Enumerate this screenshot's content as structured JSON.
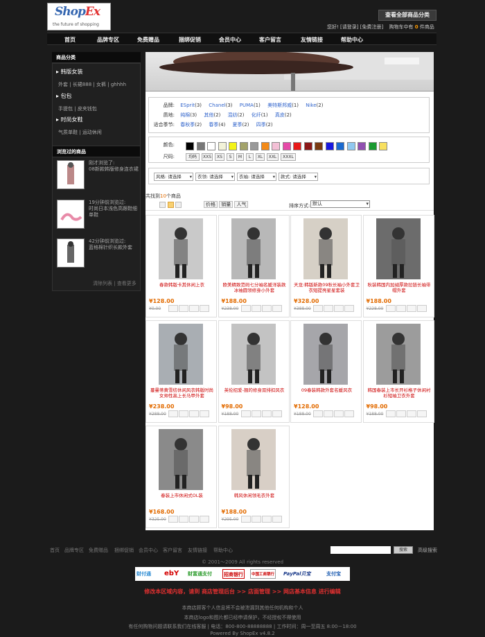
{
  "brand": {
    "logo_name": "Shop",
    "logo_mark": "Ex",
    "tagline": "the future of shopping"
  },
  "header": {
    "category_button": "查看全部商品分类",
    "greeting": "您好!",
    "login": "[请登录]",
    "register": "[免费注册]",
    "cart_prefix": "购物车中有",
    "cart_count": "0",
    "cart_suffix": "件商品"
  },
  "nav": [
    "首页",
    "品牌专区",
    "免费赠品",
    "捆绑促销",
    "会员中心",
    "客户留言",
    "友情链接",
    "帮助中心"
  ],
  "sidebar": {
    "category_title": "商品分类",
    "groups": [
      {
        "name": "韩版女装",
        "items": [
          "外套",
          "长裙888",
          "女裤",
          "ghhhh"
        ]
      },
      {
        "name": "包包",
        "items": [
          "手提包",
          "皮夹钱包"
        ]
      },
      {
        "name": "时尚女鞋",
        "items": [
          "气质单鞋",
          "运动休闲"
        ]
      }
    ],
    "history_title": "浏览过的商品",
    "history": [
      {
        "time": "刚才浏览了:",
        "name": "08新款韩版修身连衣裙"
      },
      {
        "time": "19分钟前浏览过:",
        "name": "时尚日本浅色高跟鞋细单鞋"
      },
      {
        "time": "42分钟前浏览过:",
        "name": "蓝格棉针织长款外套"
      }
    ],
    "clear_history": "清除列表",
    "more_history": "查看更多"
  },
  "filters": {
    "brand_label": "品牌:",
    "brands": [
      {
        "name": "ESprit",
        "count": "(3)"
      },
      {
        "name": "Chanel",
        "count": "(3)"
      },
      {
        "name": "PUMA",
        "count": "(1)"
      },
      {
        "name": "美特斯邦威",
        "count": "(1)"
      },
      {
        "name": "Nike",
        "count": "(2)"
      }
    ],
    "material_label": "质地:",
    "materials": [
      {
        "name": "纯棉",
        "count": "(3)"
      },
      {
        "name": "其他",
        "count": "(2)"
      },
      {
        "name": "混纺",
        "count": "(2)"
      },
      {
        "name": "化纤",
        "count": "(1)"
      },
      {
        "name": "真皮",
        "count": "(2)"
      }
    ],
    "season_label": "适合季节:",
    "seasons": [
      {
        "name": "春秋季",
        "count": "(2)"
      },
      {
        "name": "春季",
        "count": "(4)"
      },
      {
        "name": "夏季",
        "count": "(2)"
      },
      {
        "name": "四季",
        "count": "(2)"
      }
    ],
    "color_label": "颜色:",
    "colors": [
      "#000000",
      "#777777",
      "#ffffff",
      "#f2f2d8",
      "#f3f318",
      "#a3a36a",
      "#999999",
      "#f38a18",
      "#f3c0d6",
      "#e64aa8",
      "#e81818",
      "#8c1818",
      "#7a3a12",
      "#1818e0",
      "#1a6ad0",
      "#90c8f0",
      "#9050b0",
      "#1a9a30",
      "#f8e060"
    ],
    "size_label": "尺码:",
    "sizes": [
      "均码",
      "XXS",
      "XS",
      "S",
      "M",
      "L",
      "XL",
      "XXL",
      "XXXL"
    ],
    "dropdowns": [
      {
        "label": "风格:",
        "value": "请选择"
      },
      {
        "label": "衣领:",
        "value": "请选择"
      },
      {
        "label": "衣袖:",
        "value": "请选择"
      },
      {
        "label": "款式:",
        "value": "请选择"
      }
    ]
  },
  "results": {
    "prefix": "共找到",
    "count": "10",
    "suffix": "个商品"
  },
  "sort": {
    "buttons": [
      "价格",
      "销量",
      "人气"
    ],
    "label": "排序方式:",
    "value": "默认"
  },
  "products": [
    {
      "name": "春款韩版卡其休闲上衣",
      "price": "¥128.00",
      "old": "¥0.00",
      "img": "#c9c9c9"
    },
    {
      "name": "欧美精致范码七分袖名媛洋装款冰袖圆领修身小外套",
      "price": "¥188.00",
      "old": "¥238.00",
      "img": "#b8b8b8"
    },
    {
      "name": "天龙:韩版新款09秋长袖小外套卫衣短提亮星星套装",
      "price": "¥328.00",
      "old": "¥388.00",
      "img": "#d6d0c6"
    },
    {
      "name": "秋装韩国内加绒厚款拉链长袖带帽外套",
      "price": "¥188.00",
      "old": "¥228.00",
      "img": "#6c6c6c"
    },
    {
      "name": "蔓曼蒂黄雪纺休闲风衣韩版时尚女帅性高上长马甲外套",
      "price": "¥238.00",
      "old": "¥288.00",
      "img": "#a9aeb3"
    },
    {
      "name": "英伦招爱-翘的修身双排扣风衣",
      "price": "¥98.00",
      "old": "¥188.00",
      "img": "#c3c3c3"
    },
    {
      "name": "09春装韩款外套名媛风衣",
      "price": "¥128.00",
      "old": "¥188.00",
      "img": "#a6a6aa"
    },
    {
      "name": "韩国春装上市长开衫格子休闲衬衫短袖卫衣外套",
      "price": "¥98.00",
      "old": "¥188.00",
      "img": "#9c9c9c"
    },
    {
      "name": "春装上市休闲式OL装",
      "price": "¥168.00",
      "old": "¥325.00",
      "img": "#8a8a8a"
    },
    {
      "name": "韩风休闲领毛衣外套",
      "price": "¥188.00",
      "old": "¥295.00",
      "img": "#d8cfc6"
    }
  ],
  "footer": {
    "links": [
      "首页",
      "品牌专区",
      "免费赠品",
      "捆绑促销",
      "会员中心",
      "客户留言",
      "友情链接",
      "帮助中心"
    ],
    "search_button": "搜索",
    "advanced_search": "高级搜索",
    "copyright": "© 2001～2009 All rights reserved",
    "payments": [
      "财付通",
      "ebY",
      "财富通支付",
      "招商银行",
      "中国工商银行",
      "PayPal贝宝",
      "支付宝"
    ],
    "admin_line": "修改本区域内容，请到 商店管理后台 >> 店面管理 >> 网店基本信息 进行编辑",
    "lines": [
      "本商店顾客个人信息将不会被泄漏到其他任何机构和个人",
      "本商店logo和图片都已经申请保护，不经授权不得使用",
      "有任何购物问题请联系我们在线客服 | 电话：800-800-88888888 | 工作时间：周一至周五 8:00－18:00"
    ],
    "powered": "Powered By ShopEx v4.8.2"
  }
}
